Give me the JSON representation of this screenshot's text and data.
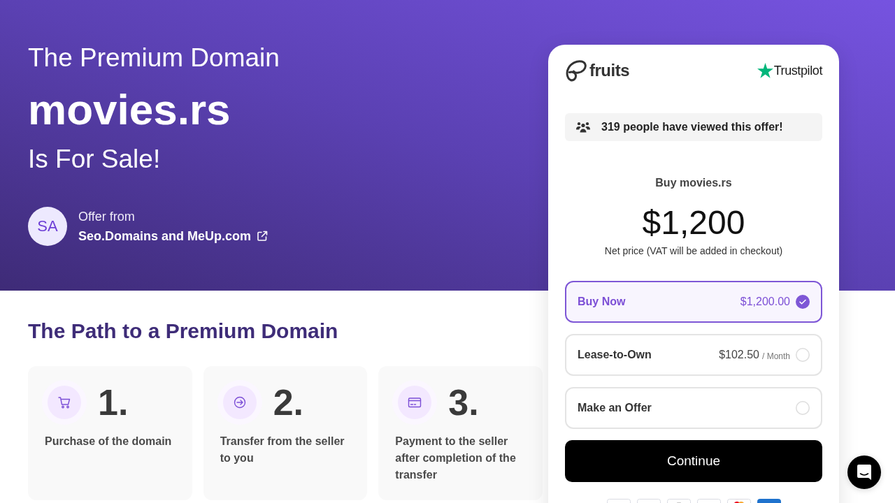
{
  "hero": {
    "eyebrow": "The Premium Domain",
    "domain": "movies.rs",
    "tagline": "Is For Sale!",
    "seller": {
      "initials": "SA",
      "label": "Offer from",
      "name": "Seo.Domains and MeUp.com"
    }
  },
  "steps": {
    "title": "The Path to a Premium Domain",
    "items": [
      {
        "kind": "cart",
        "number": "1.",
        "text": "Purchase of the domain"
      },
      {
        "kind": "transfer",
        "number": "2.",
        "text": "Transfer from the seller to you"
      },
      {
        "kind": "payment",
        "number": "3.",
        "text": "Payment to the seller after completion of the transfer"
      }
    ]
  },
  "checkout": {
    "brand": "fruits",
    "rating_brand": "Trustpilot",
    "views_notice": "319 people have viewed this offer!",
    "heading": "Buy movies.rs",
    "price": "$1,200",
    "price_note": "Net price (VAT will be added in checkout)",
    "options": [
      {
        "label": "Buy Now",
        "price": "$1,200.00",
        "selected": true
      },
      {
        "label": "Lease-to-Own",
        "price": "$102.50",
        "period": "/ Month",
        "selected": false
      },
      {
        "label": "Make an Offer",
        "selected": false
      }
    ],
    "continue_button": "Continue"
  }
}
